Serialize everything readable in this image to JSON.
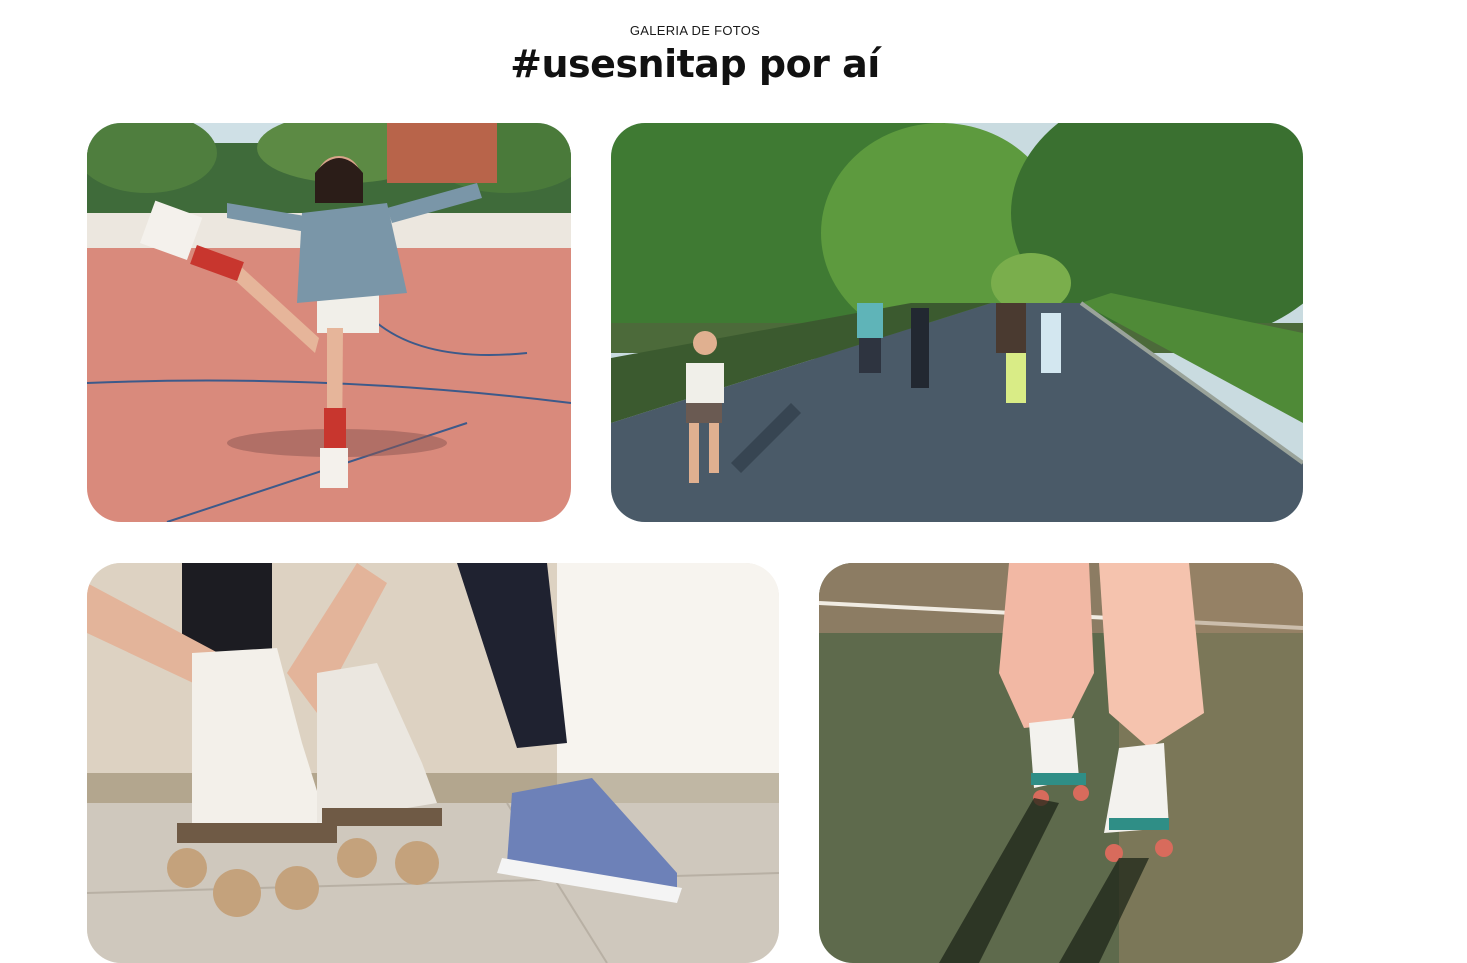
{
  "gallery": {
    "eyebrow": "GALERIA DE FOTOS",
    "title": "#usesnitap por aí"
  },
  "photos": [
    {
      "subject": "woman roller skating with one leg raised on a court"
    },
    {
      "subject": "group of people roller skating on a tree-lined park road"
    },
    {
      "subject": "hands tying laces of white roller skates next to a sneaker"
    },
    {
      "subject": "legs in pink pants wearing white roller skates on court"
    }
  ],
  "colors": {
    "text": "#111111",
    "background": "#ffffff"
  }
}
